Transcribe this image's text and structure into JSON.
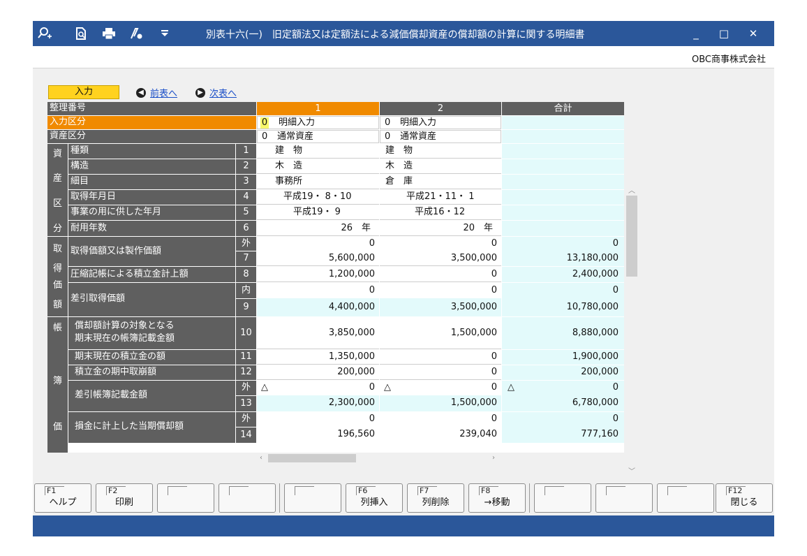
{
  "window": {
    "title": "別表十六(一)　旧定額法又は定額法による減価償却資産の償却額の計算に関する明細書",
    "company": "OBC商事株式会社",
    "controls": [
      "_",
      "□",
      "✕"
    ]
  },
  "toolbar": {
    "icons": [
      "search-plus-icon",
      "find-icon",
      "printer-icon",
      "signature-icon",
      "dropdown-icon"
    ]
  },
  "nav": {
    "input_label": "入力",
    "prev_label": "前表へ",
    "next_label": "次表へ"
  },
  "table": {
    "header": {
      "id_label": "整理番号",
      "col1": "1",
      "col2": "2",
      "total": "合計"
    },
    "input_type": {
      "label": "入力区分",
      "c1_code": "0",
      "c1_text": "明細入力",
      "c2_code": "0",
      "c2_text": "明細入力"
    },
    "asset_type": {
      "label": "資産区分",
      "c1_code": "0",
      "c1_text": "通常資産",
      "c2_code": "0",
      "c2_text": "通常資産"
    },
    "groups": {
      "shisan": [
        "資",
        "産",
        "区",
        "分"
      ],
      "shutoku": [
        "取",
        "得",
        "価",
        "額"
      ],
      "chobo": [
        "帳",
        "簿",
        "価"
      ]
    },
    "rows": {
      "r1": {
        "num": "1",
        "label": "種類",
        "c1": "建　物",
        "c2": "建　物"
      },
      "r2": {
        "num": "2",
        "label": "構造",
        "c1": "木　造",
        "c2": "木　造"
      },
      "r3": {
        "num": "3",
        "label": "細目",
        "c1": "事務所",
        "c2": "倉　庫"
      },
      "r4": {
        "num": "4",
        "label": "取得年月日",
        "c1": "平成19・ 8・10",
        "c2": "平成21・11・ 1"
      },
      "r5": {
        "num": "5",
        "label": "事業の用に供した年月",
        "c1": "平成19・ 9",
        "c2": "平成16・12"
      },
      "r6": {
        "num": "6",
        "label": "耐用年数",
        "c1": "26　年",
        "c2": "20　年"
      },
      "r7": {
        "num": "7",
        "sub": "外",
        "label": "取得価額又は製作価額",
        "c1_top": "0",
        "c2_top": "0",
        "tot_top": "0",
        "c1": "5,600,000",
        "c2": "3,500,000",
        "tot": "13,180,000"
      },
      "r8": {
        "num": "8",
        "label": "圧縮記帳による積立金計上額",
        "c1": "1,200,000",
        "c2": "0",
        "tot": "2,400,000"
      },
      "r9": {
        "num": "9",
        "sub": "内",
        "label": "差引取得価額",
        "c1_top": "0",
        "c2_top": "0",
        "tot_top": "0",
        "c1": "4,400,000",
        "c2": "3,500,000",
        "tot": "10,780,000"
      },
      "r10": {
        "num": "10",
        "label1": "償却額計算の対象となる",
        "label2": "期末現在の帳簿記載金額",
        "c1": "3,850,000",
        "c2": "1,500,000",
        "tot": "8,880,000"
      },
      "r11": {
        "num": "11",
        "label": "期末現在の積立金の額",
        "c1": "1,350,000",
        "c2": "0",
        "tot": "1,900,000"
      },
      "r12": {
        "num": "12",
        "label": "積立金の期中取崩額",
        "c1": "200,000",
        "c2": "0",
        "tot": "200,000"
      },
      "r13": {
        "num": "13",
        "sub": "外",
        "label": "差引帳簿記載金額",
        "tri": "△",
        "c1_top": "0",
        "c2_top": "0",
        "tot_top": "0",
        "c1": "2,300,000",
        "c2": "1,500,000",
        "tot": "6,780,000"
      },
      "r14": {
        "num": "14",
        "sub": "外",
        "label": "損金に計上した当期償却額",
        "c1_top": "0",
        "c2_top": "0",
        "tot_top": "0",
        "c1": "196,560",
        "c2": "239,040",
        "tot": "777,160"
      }
    }
  },
  "fkeys": [
    {
      "code": "F1",
      "label": "ヘルプ"
    },
    {
      "code": "F2",
      "label": "印刷"
    },
    {
      "code": "",
      "label": ""
    },
    {
      "code": "",
      "label": ""
    },
    {
      "code": "",
      "label": ""
    },
    {
      "code": "F6",
      "label": "列挿入"
    },
    {
      "code": "F7",
      "label": "列削除"
    },
    {
      "code": "F8",
      "label": "→移動"
    },
    {
      "code": "",
      "label": ""
    },
    {
      "code": "",
      "label": ""
    },
    {
      "code": "",
      "label": ""
    },
    {
      "code": "F12",
      "label": "閉じる"
    }
  ],
  "colors": {
    "titlebar": "#2b579a",
    "header": "#5f5f5f",
    "accent_orange": "#f08a00",
    "input_badge": "#ffd21f",
    "total_cell": "#e3fafb"
  }
}
